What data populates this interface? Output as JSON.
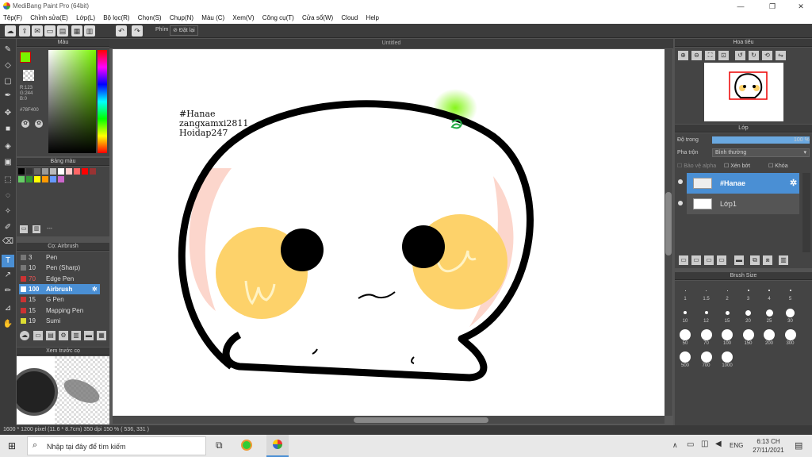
{
  "window": {
    "title": "MediBang Paint Pro (64bit)",
    "controls": [
      "—",
      "❐",
      "✕"
    ]
  },
  "menu": [
    "Tệp(F)",
    "Chỉnh sửa(E)",
    "Lớp(L)",
    "Bộ lọc(R)",
    "Chọn(S)",
    "Chụp(N)",
    "Màu (C)",
    "Xem(V)",
    "Công cụ(T)",
    "Cửa sổ(W)",
    "Cloud",
    "Help"
  ],
  "toolbar": {
    "label_key": "Phím",
    "reset_label": "Đặt lại"
  },
  "color_panel": {
    "title": "Màu",
    "rgb": [
      "R:123",
      "G:244",
      "B:0"
    ],
    "hex": "#78F400",
    "primary_color": "#78f400"
  },
  "palette_panel": {
    "title": "Bảng màu",
    "swatches": [
      "#000000",
      "#333333",
      "#666666",
      "#999999",
      "#bbbbbb",
      "#ffffff",
      "#ffcccc",
      "#ff6666",
      "#ff0000",
      "#993333",
      "#66cc66",
      "#339933",
      "#ffff00",
      "#ff9900",
      "#6699ff",
      "#cc66cc"
    ],
    "footer": "---"
  },
  "brush_panel": {
    "title": "Cọ: Airbrush",
    "items": [
      {
        "size": "3",
        "name": "Pen",
        "color": "#777777"
      },
      {
        "size": "10",
        "name": "Pen (Sharp)",
        "color": "#777777"
      },
      {
        "size": "70",
        "name": "Edge Pen",
        "color": "#cc3333"
      },
      {
        "size": "100",
        "name": "Airbrush",
        "color": "#ffffff"
      },
      {
        "size": "15",
        "name": "G Pen",
        "color": "#cc3333"
      },
      {
        "size": "15",
        "name": "Mapping Pen",
        "color": "#cc3333"
      },
      {
        "size": "19",
        "name": "Sumi",
        "color": "#dddd33"
      }
    ]
  },
  "preview_panel": {
    "title": "Xem trước cọ"
  },
  "document": {
    "tab": "Untitled",
    "watermark": [
      "#Hanae",
      "zangxamxi2811",
      "Hoidap247"
    ]
  },
  "navigator_panel": {
    "title": "Hoa tiêu"
  },
  "layer_panel": {
    "title": "Lớp",
    "opacity_label": "Độ trong",
    "opacity_value": "100 %",
    "opacity_fraction": 1.0,
    "blend_label": "Pha trộn",
    "blend_value": "Bình thường",
    "protect_alpha": "Bảo vệ alpha",
    "clipping": "Xén bớt",
    "lock": "Khóa",
    "layers": [
      {
        "name": "#Hanae",
        "selected": true
      },
      {
        "name": "Lớp1",
        "selected": false
      }
    ]
  },
  "brush_size_panel": {
    "title": "Brush Size",
    "sizes": [
      "1",
      "1.5",
      "2",
      "3",
      "4",
      "5",
      "10",
      "12",
      "15",
      "20",
      "25",
      "30",
      "50",
      "70",
      "100",
      "150",
      "200",
      "300",
      "500",
      "700",
      "1000"
    ]
  },
  "status": "1600 * 1200 pixel   (11.6 * 8.7cm)   350 dpi   150 %   ( 536, 331 )",
  "taskbar": {
    "search_placeholder": "Nhập tại đây để tìm kiếm",
    "lang": "ENG",
    "time": "6:13 CH",
    "date": "27/11/2021"
  }
}
